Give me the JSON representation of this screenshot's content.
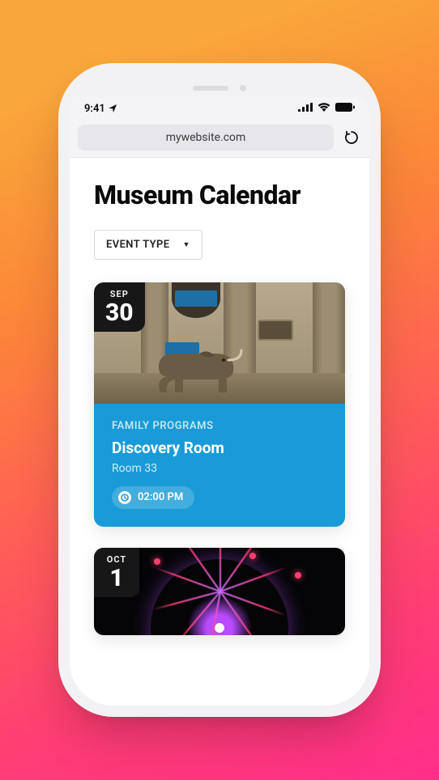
{
  "status": {
    "time": "9:41",
    "wifi": true,
    "battery": true
  },
  "browser": {
    "url": "mywebsite.com"
  },
  "page": {
    "title": "Museum Calendar"
  },
  "filter": {
    "label": "EVENT TYPE"
  },
  "events": [
    {
      "month": "SEP",
      "day": "30",
      "category": "FAMILY PROGRAMS",
      "title": "Discovery Room",
      "room": "Room 33",
      "time": "02:00 PM"
    },
    {
      "month": "OCT",
      "day": "1"
    }
  ]
}
